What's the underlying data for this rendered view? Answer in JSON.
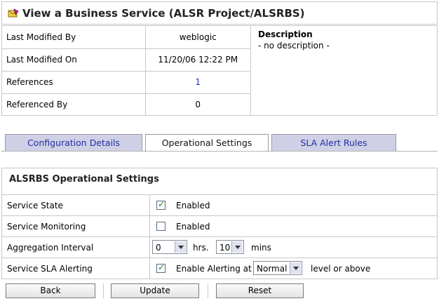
{
  "page": {
    "title": "View a Business Service (ALSR Project/ALSRBS)",
    "title_icon": "business-service-icon"
  },
  "info": {
    "rows": [
      {
        "label": "Last Modified By",
        "value": "weblogic"
      },
      {
        "label": "Last Modified On",
        "value": "11/20/06 12:22 PM"
      },
      {
        "label": "References",
        "value": "1"
      },
      {
        "label": "Referenced By",
        "value": "0"
      }
    ],
    "description_label": "Description",
    "description_value": "- no description -"
  },
  "tabs": [
    {
      "label": "Configuration Details",
      "active": false
    },
    {
      "label": "Operational Settings",
      "active": true
    },
    {
      "label": "SLA Alert Rules",
      "active": false
    }
  ],
  "ops": {
    "title": "ALSRBS Operational Settings",
    "service_state": {
      "label": "Service State",
      "checked": true,
      "text": "Enabled"
    },
    "service_monitoring": {
      "label": "Service Monitoring",
      "checked": false,
      "text": "Enabled"
    },
    "aggregation": {
      "label": "Aggregation Interval",
      "hours_value": "0",
      "hours_unit": "hrs.",
      "mins_value": "10",
      "mins_unit": "mins"
    },
    "sla_alerting": {
      "label": "Service SLA Alerting",
      "checked": true,
      "text": "Enable Alerting at",
      "level_value": "Normal",
      "suffix": "level or above"
    }
  },
  "buttons": {
    "back": "Back",
    "update": "Update",
    "reset": "Reset"
  },
  "colors": {
    "link": "#1f2fc0",
    "tab_inactive_bg": "#cfd0e6",
    "check_mark": "#1b7a1b"
  }
}
